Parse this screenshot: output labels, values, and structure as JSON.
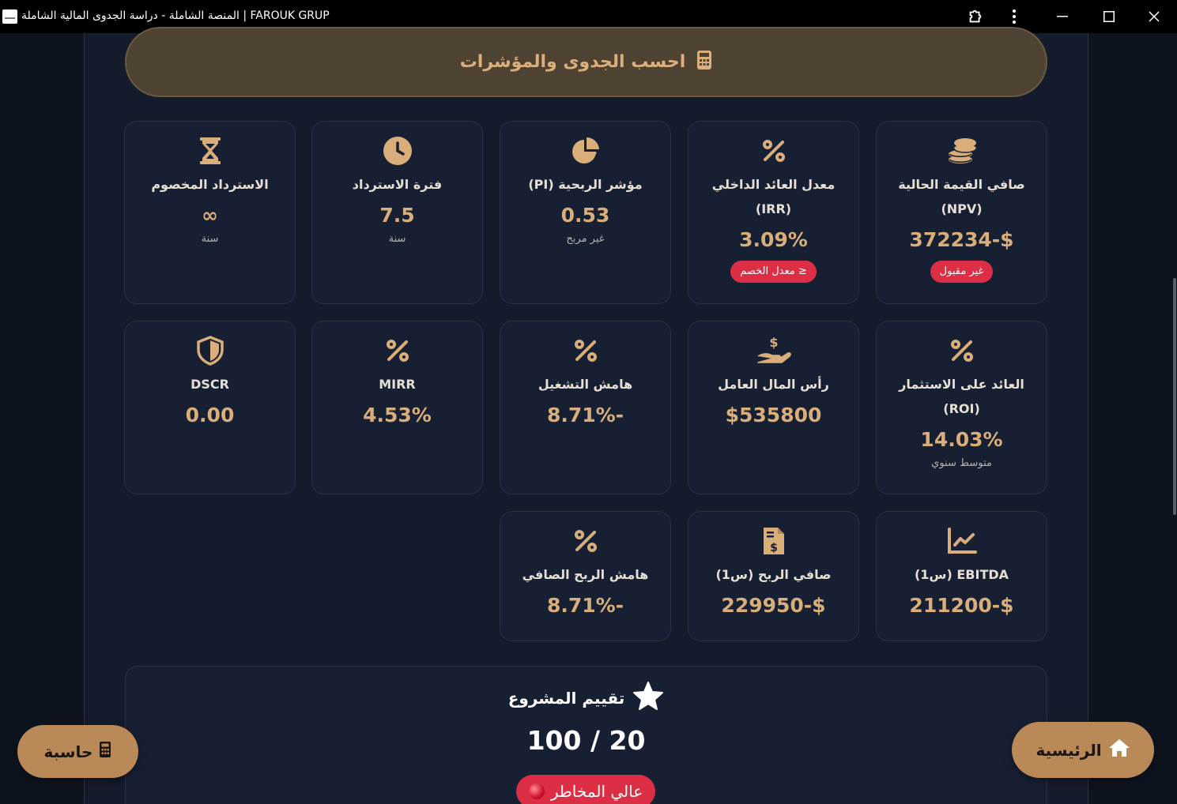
{
  "window": {
    "title": "المنصة الشاملة - دراسة الجدوى المالية الشاملة | FAROUK GRUP"
  },
  "calc_button": {
    "label": "احسب الجدوى والمؤشرات"
  },
  "cards": {
    "npv": {
      "label": "صافي القيمة الحالية (NPV)",
      "value": "372234-$",
      "badge": "غير مقبول",
      "icon": "coins-icon"
    },
    "irr": {
      "label": "معدل العائد الداخلي (IRR)",
      "value": "3.09%",
      "badge": "≤ معدل الخصم",
      "icon": "percent-icon"
    },
    "pi": {
      "label": "مؤشر الربحية (PI)",
      "value": "0.53",
      "sub": "غير مربح",
      "icon": "pie-chart-icon"
    },
    "payback": {
      "label": "فترة الاسترداد",
      "value": "7.5",
      "sub": "سنة",
      "icon": "clock-icon"
    },
    "discounted_payback": {
      "label": "الاسترداد المخصوم",
      "value": "∞",
      "sub": "سنة",
      "icon": "hourglass-icon"
    },
    "roi": {
      "label": "العائد على الاستثمار (ROI)",
      "value": "14.03%",
      "sub": "متوسط سنوي",
      "icon": "percent-icon"
    },
    "working_capital": {
      "label": "رأس المال العامل",
      "value": "$535800",
      "icon": "hand-dollar-icon"
    },
    "operating_margin": {
      "label": "هامش التشغيل",
      "value": "8.71%-",
      "icon": "percent-icon"
    },
    "mirr": {
      "label": "MIRR",
      "value": "4.53%",
      "icon": "percent-icon"
    },
    "dscr": {
      "label": "DSCR",
      "value": "0.00",
      "icon": "shield-icon"
    },
    "ebitda": {
      "label": "EBITDA (س1)",
      "value": "211200-$",
      "icon": "line-chart-icon"
    },
    "net_profit": {
      "label": "صافي الربح (س1)",
      "value": "229950-$",
      "icon": "invoice-dollar-icon"
    },
    "net_margin": {
      "label": "هامش الربح الصافي",
      "value": "8.71%-",
      "icon": "percent-icon"
    }
  },
  "evaluation": {
    "title": "تقييم المشروع",
    "score": "100 / 20",
    "risk": "عالي المخاطر"
  },
  "fab": {
    "calculator": "حاسبة",
    "home": "الرئيسية"
  },
  "colors": {
    "accent": "#d9ae7a",
    "card_bg": "#172033",
    "danger": "#dc2f45",
    "page_bg": "#141b2a"
  }
}
